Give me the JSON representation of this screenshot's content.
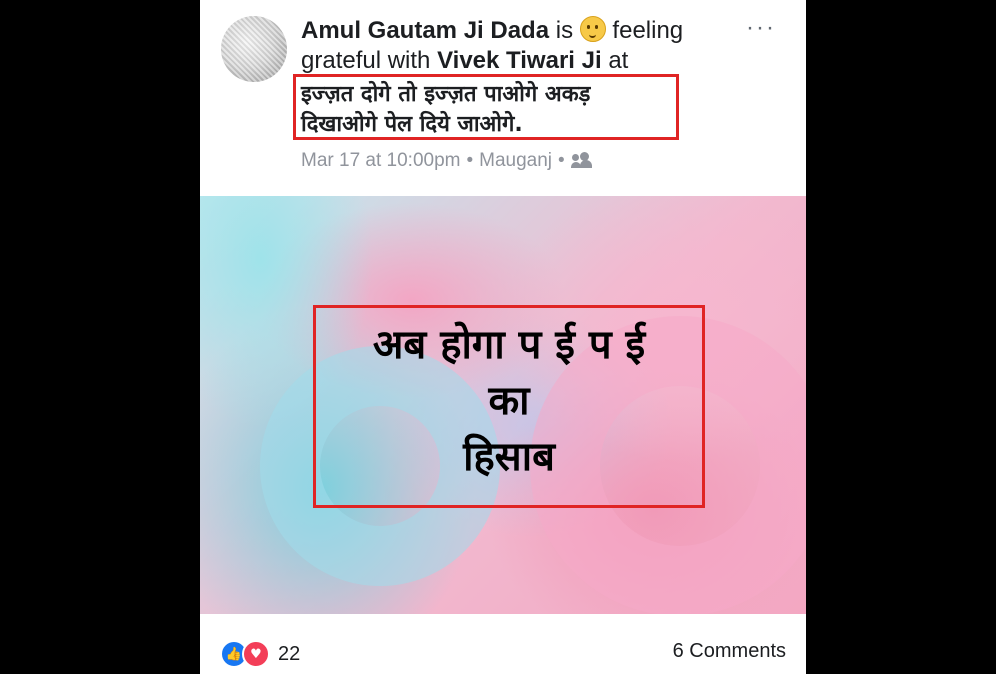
{
  "post": {
    "author": "Amul Gautam Ji Dada",
    "is": "is",
    "feeling": "feeling",
    "grateful_with": "grateful with",
    "tagged": "Vivek Tiwari Ji",
    "at": "at",
    "status_line1": "इज्ज़त दोगे तो इज्ज़त पाओगे अकड़",
    "status_line2": "दिखाओगे पेल दिये जाओगे.",
    "timestamp": "Mar 17 at 10:00pm",
    "location": "Mauganj",
    "separator": "•",
    "audience_icon": "friends-icon",
    "more_label": "···"
  },
  "photo": {
    "line1": "अब होगा प ई प ई",
    "line2": "का",
    "line3": "हिसाब"
  },
  "footer": {
    "reaction_count": "22",
    "comments": "6 Comments",
    "like_icon": "👍",
    "love_icon": "♥"
  },
  "colors": {
    "highlight_box": "#e02424",
    "like": "#1877f2",
    "love": "#f33e58"
  }
}
